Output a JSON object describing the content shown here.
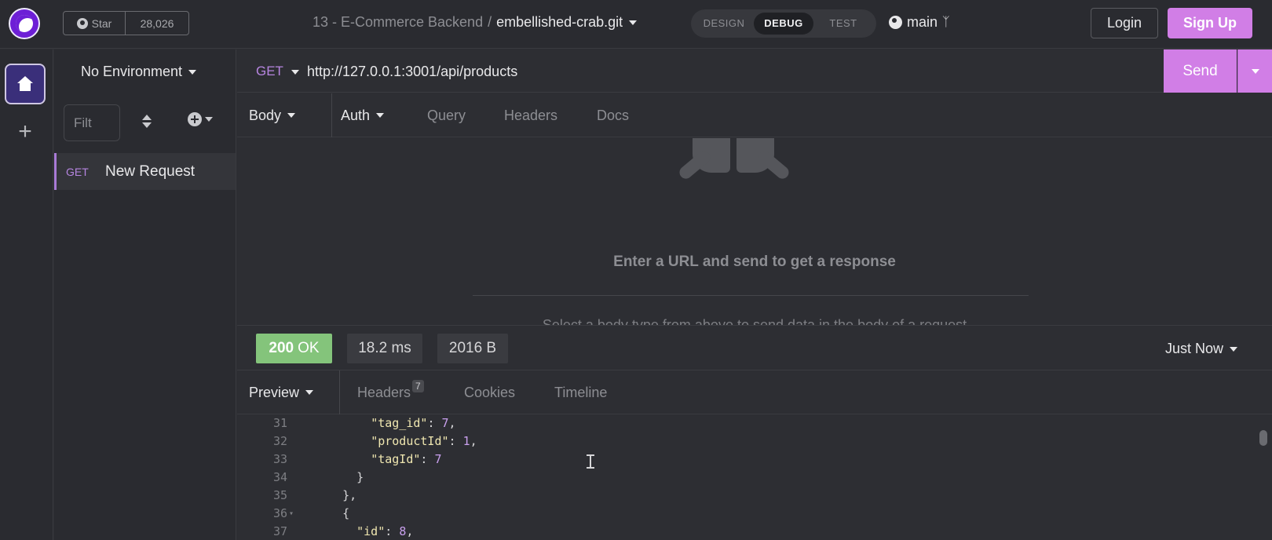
{
  "app": {
    "logo_icon": "insomnia-logo-icon"
  },
  "github_badge": {
    "star_label": "Star",
    "count": "28,026",
    "icon": "github-icon"
  },
  "breadcrumb": {
    "project": "13 - E-Commerce Backend",
    "separator": "/",
    "repo": "embellished-crab.git"
  },
  "modes": [
    {
      "label": "DESIGN",
      "active": false
    },
    {
      "label": "DEBUG",
      "active": true
    },
    {
      "label": "TEST",
      "active": false
    }
  ],
  "branch": {
    "name": "main",
    "icon": "git-branch-icon"
  },
  "auth": {
    "login_label": "Login",
    "signup_label": "Sign Up"
  },
  "colors": {
    "accent": "#d17ee6",
    "method_get": "#b685e0",
    "status_ok": "#84c47b"
  },
  "sidebar": {
    "environment": "No Environment",
    "filter_placeholder": "Filter",
    "filter_visible_text": "Filt",
    "requests": [
      {
        "method": "GET",
        "name": "New Request"
      }
    ]
  },
  "request": {
    "method": "GET",
    "url": "http://127.0.0.1:3001/api/products",
    "send_label": "Send",
    "tabs": [
      {
        "label": "Body",
        "dropdown": true,
        "active": true
      },
      {
        "label": "Auth",
        "dropdown": true,
        "active": false
      },
      {
        "label": "Query",
        "dropdown": false,
        "active": false
      },
      {
        "label": "Headers",
        "dropdown": false,
        "active": false
      },
      {
        "label": "Docs",
        "dropdown": false,
        "active": false
      }
    ],
    "empty_title": "Enter a URL and send to get a response",
    "empty_hint": "Select a body type from above to send data in the body of a request"
  },
  "response": {
    "status_code": "200",
    "status_text": "OK",
    "time": "18.2 ms",
    "size": "2016 B",
    "history": "Just Now",
    "tabs": [
      {
        "label": "Preview",
        "dropdown": true,
        "active": true
      },
      {
        "label": "Headers",
        "count": "7",
        "active": false
      },
      {
        "label": "Cookies",
        "active": false
      },
      {
        "label": "Timeline",
        "active": false
      }
    ],
    "lines": [
      {
        "num": "31",
        "indent": "      ",
        "key": "\"tag_id\"",
        "sep": ": ",
        "value": "7",
        "tail": ","
      },
      {
        "num": "32",
        "indent": "      ",
        "key": "\"productId\"",
        "sep": ": ",
        "value": "1",
        "tail": ","
      },
      {
        "num": "33",
        "indent": "      ",
        "key": "\"tagId\"",
        "sep": ": ",
        "value": "7",
        "tail": ""
      },
      {
        "num": "34",
        "indent": "    ",
        "key": "",
        "sep": "",
        "value": "",
        "tail": "}"
      },
      {
        "num": "35",
        "indent": "  ",
        "key": "",
        "sep": "",
        "value": "",
        "tail": "},"
      },
      {
        "num": "36",
        "indent": "  ",
        "key": "",
        "sep": "",
        "value": "",
        "tail": "{",
        "fold": true
      },
      {
        "num": "37",
        "indent": "    ",
        "key": "\"id\"",
        "sep": ": ",
        "value": "8",
        "tail": ","
      }
    ]
  }
}
